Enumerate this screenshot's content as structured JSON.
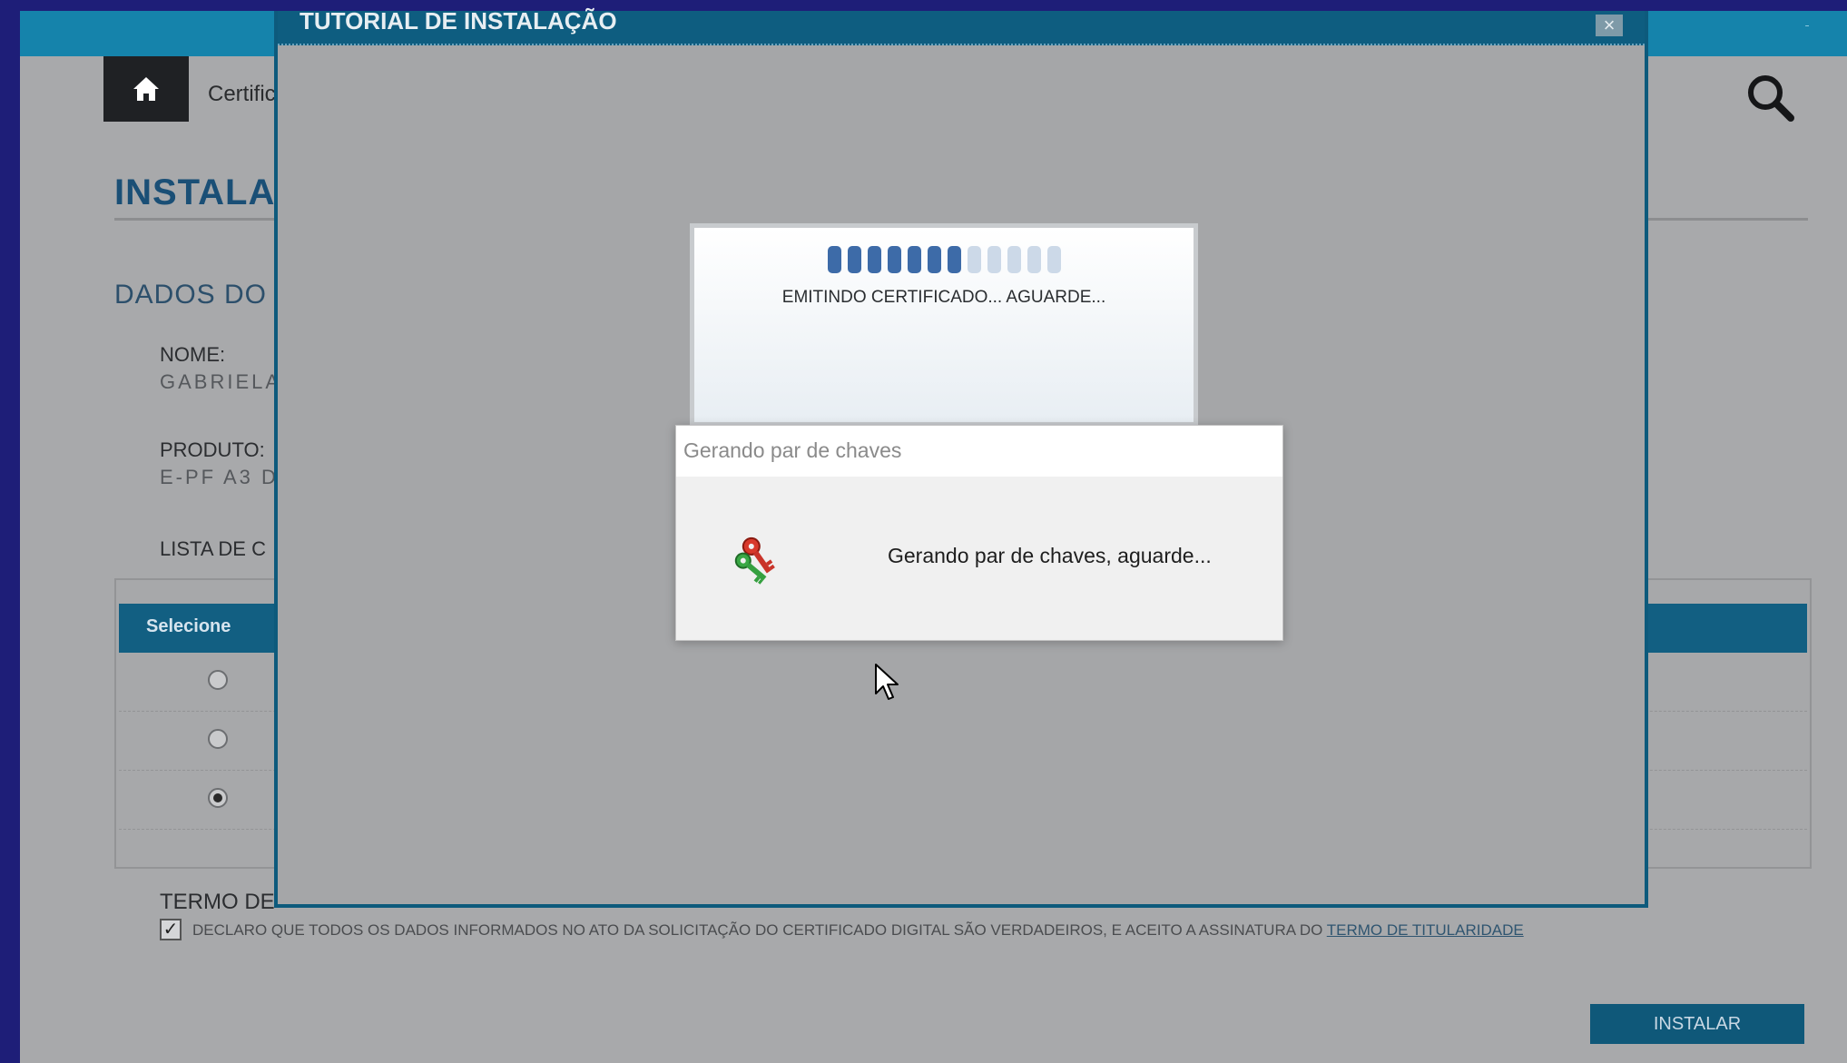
{
  "breadcrumb": "Certific",
  "page_title": "INSTALA",
  "section_title": "DADOS DO",
  "fields": {
    "name_label": "NOME:",
    "name_value": "GABRIELA",
    "product_label": "PRODUTO:",
    "product_value": "E-PF A3 D",
    "list_label": "LISTA DE C"
  },
  "table": {
    "header": "Selecione",
    "rows": [
      {
        "selected": false
      },
      {
        "selected": false
      },
      {
        "selected": true
      }
    ]
  },
  "terms": {
    "label": "TERMO DE",
    "checked": true,
    "text": "DECLARO QUE TODOS OS DADOS INFORMADOS NO ATO DA SOLICITAÇÃO DO CERTIFICADO DIGITAL SÃO VERDADEIROS, E ACEITO A ASSINATURA DO ",
    "link": "TERMO DE TITULARIDADE"
  },
  "install_button": "INSTALAR",
  "modal": {
    "title": "TUTORIAL DE INSTALAÇÃO",
    "close_symbol": "×"
  },
  "progress": {
    "segments_total": 12,
    "segments_filled": 7,
    "text": "EMITINDO CERTIFICADO... AGUARDE..."
  },
  "key_dialog": {
    "title": "Gerando par de chaves",
    "message": "Gerando par de chaves, aguarde..."
  },
  "colors": {
    "brand_blue": "#1583ab",
    "modal_blue": "#0e5d80",
    "progress_on": "#3d6ba8",
    "progress_off": "#ccd9e8"
  },
  "icons": [
    "home-icon",
    "search-icon",
    "keys-icon",
    "close-icon",
    "cursor-icon",
    "checkmark-icon"
  ]
}
